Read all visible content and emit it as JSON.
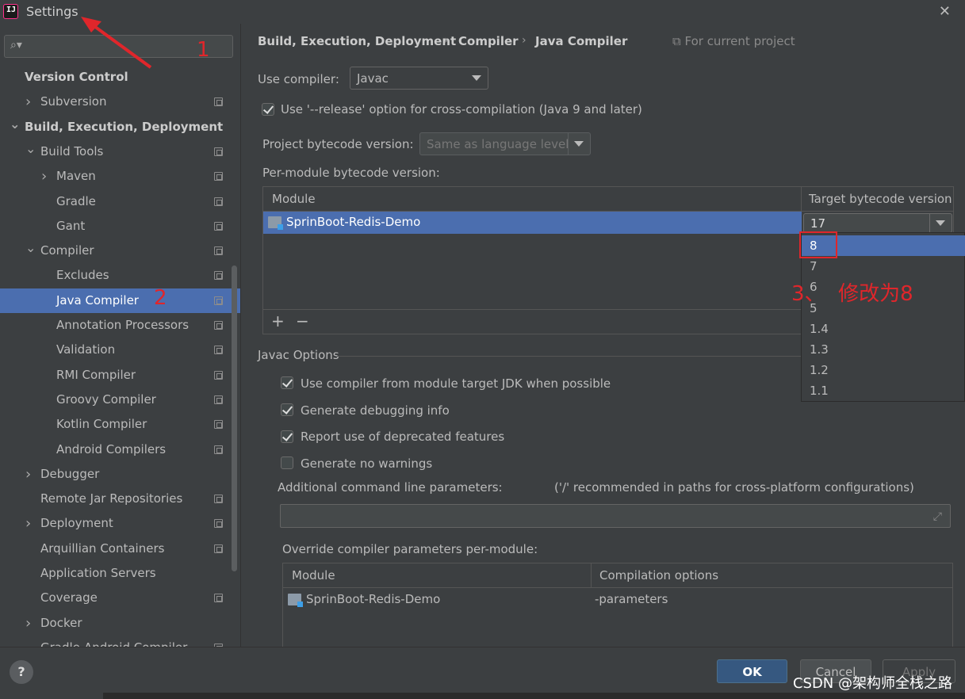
{
  "window": {
    "title": "Settings",
    "app_icon": "intellij-icon",
    "close_icon": "close-icon"
  },
  "sidebar": {
    "search_placeholder": "",
    "items": [
      {
        "label": "Version Control",
        "level": 0,
        "bold": true
      },
      {
        "label": "Subversion",
        "level": 1,
        "chevron": "right",
        "project_icon": true
      },
      {
        "label": "Build, Execution, Deployment",
        "level": 0,
        "bold": true,
        "chevron": "down"
      },
      {
        "label": "Build Tools",
        "level": 1,
        "chevron": "down",
        "project_icon": true
      },
      {
        "label": "Maven",
        "level": 2,
        "chevron": "right",
        "project_icon": true
      },
      {
        "label": "Gradle",
        "level": 2,
        "project_icon": true
      },
      {
        "label": "Gant",
        "level": 2,
        "project_icon": true
      },
      {
        "label": "Compiler",
        "level": 1,
        "chevron": "down",
        "project_icon": true
      },
      {
        "label": "Excludes",
        "level": 2,
        "project_icon": true
      },
      {
        "label": "Java Compiler",
        "level": 2,
        "selected": true,
        "project_icon": true
      },
      {
        "label": "Annotation Processors",
        "level": 2,
        "project_icon": true
      },
      {
        "label": "Validation",
        "level": 2,
        "project_icon": true
      },
      {
        "label": "RMI Compiler",
        "level": 2,
        "project_icon": true
      },
      {
        "label": "Groovy Compiler",
        "level": 2,
        "project_icon": true
      },
      {
        "label": "Kotlin Compiler",
        "level": 2,
        "project_icon": true
      },
      {
        "label": "Android Compilers",
        "level": 2,
        "project_icon": true
      },
      {
        "label": "Debugger",
        "level": 1,
        "chevron": "right"
      },
      {
        "label": "Remote Jar Repositories",
        "level": 1,
        "project_icon": true
      },
      {
        "label": "Deployment",
        "level": 1,
        "chevron": "right",
        "project_icon": true
      },
      {
        "label": "Arquillian Containers",
        "level": 1,
        "project_icon": true
      },
      {
        "label": "Application Servers",
        "level": 1
      },
      {
        "label": "Coverage",
        "level": 1,
        "project_icon": true
      },
      {
        "label": "Docker",
        "level": 1,
        "chevron": "right"
      },
      {
        "label": "Gradle-Android Compiler",
        "level": 1,
        "project_icon": true
      }
    ]
  },
  "breadcrumb": {
    "parts": [
      "Build, Execution, Deployment",
      "Compiler",
      "Java Compiler"
    ],
    "separator": "›",
    "scope": "For current project"
  },
  "compiler": {
    "use_compiler_label": "Use compiler:",
    "use_compiler_value": "Javac",
    "release_option_label": "Use '--release' option for cross-compilation (Java 9 and later)",
    "release_option_checked": true,
    "project_bytecode_label": "Project bytecode version:",
    "project_bytecode_value": "Same as language level",
    "per_module_label": "Per-module bytecode version:"
  },
  "module_table": {
    "col_module": "Module",
    "col_target": "Target bytecode version",
    "rows": [
      {
        "module": "SprinBoot-Redis-Demo",
        "target": "17"
      }
    ],
    "add_label": "+",
    "remove_label": "−"
  },
  "target_dropdown": {
    "options": [
      "8",
      "7",
      "6",
      "5",
      "1.4",
      "1.3",
      "1.2",
      "1.1"
    ],
    "highlighted": "8"
  },
  "javac_options": {
    "title": "Javac Options",
    "checkboxes": [
      {
        "label": "Use compiler from module target JDK when possible",
        "checked": true
      },
      {
        "label": "Generate debugging info",
        "checked": true
      },
      {
        "label": "Report use of deprecated features",
        "checked": true
      },
      {
        "label": "Generate no warnings",
        "checked": false
      }
    ],
    "additional_params_label": "Additional command line parameters:",
    "additional_params_hint": "('/' recommended in paths for cross-platform configurations)",
    "additional_params_value": "",
    "override_label": "Override compiler parameters per-module:",
    "override_table": {
      "col_module": "Module",
      "col_options": "Compilation options",
      "rows": [
        {
          "module": "SprinBoot-Redis-Demo",
          "options": "-parameters"
        }
      ]
    }
  },
  "footer": {
    "help": "?",
    "ok": "OK",
    "cancel": "Cancel",
    "apply": "Apply"
  },
  "annotations": {
    "step1": "1",
    "step2": "2",
    "step3": "3、  修改为8",
    "color": "#e0262b"
  },
  "watermark": "CSDN @架构师全栈之路"
}
